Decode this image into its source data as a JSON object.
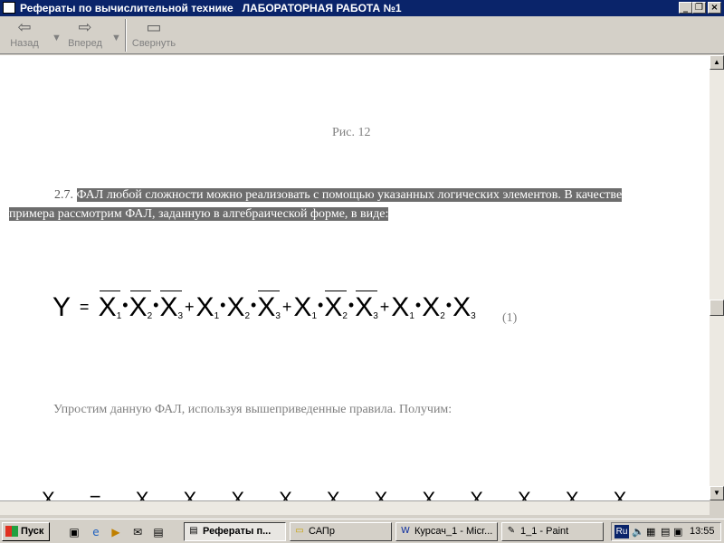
{
  "window": {
    "title": "Рефераты по вычислительной технике   ЛАБОРАТОРНАЯ РАБОТА №1",
    "icon": "document-icon"
  },
  "toolbar": {
    "back_label": "Назад",
    "forward_label": "Вперед",
    "minimize_label": "Свернуть"
  },
  "document": {
    "figure_caption": "Рис. 12",
    "para_number": "2.7.",
    "para_text": "ФАЛ любой сложности можно реализовать с помощью указанных логических элементов. В качестве примера рассмотрим ФАЛ, заданную в алгебраической форме, в виде:",
    "formula_lhs": "Y",
    "formula_eq": "=",
    "formula_number": "(1)",
    "simplify_text": "Упростим данную ФАЛ, используя вышеприведенные правила. Получим:"
  },
  "taskbar": {
    "start_label": "Пуск",
    "tasks": [
      {
        "label": "Рефераты п...",
        "active": true
      },
      {
        "label": "САПр",
        "active": false
      },
      {
        "label": "Курсач_1 - Micr...",
        "active": false
      },
      {
        "label": "1_1 - Paint",
        "active": false
      }
    ],
    "lang": "Ru",
    "clock": "13:55"
  }
}
